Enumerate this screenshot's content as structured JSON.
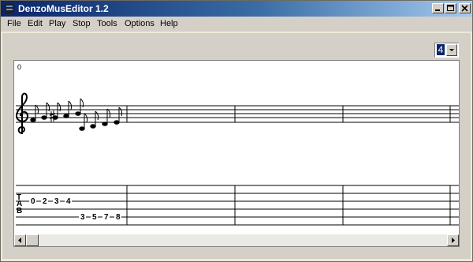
{
  "window": {
    "title": "DenzoMusEditor 1.2",
    "icon": "app-icon",
    "controls": [
      "minimize-icon",
      "maximize-icon",
      "close-icon"
    ]
  },
  "menu": {
    "items": [
      {
        "label": "File"
      },
      {
        "label": "Edit"
      },
      {
        "label": "Play"
      },
      {
        "label": "Stop"
      },
      {
        "label": "Tools"
      },
      {
        "label": "Options"
      },
      {
        "label": "Help"
      }
    ]
  },
  "toolbar": {
    "selector_value": "4"
  },
  "score": {
    "measure_number": "0",
    "tab_label": [
      "T",
      "A",
      "B"
    ],
    "tab_high_notes": [
      "0",
      "2",
      "3",
      "4"
    ],
    "tab_low_notes": [
      "3",
      "5",
      "7",
      "8"
    ]
  },
  "colors": {
    "titlebar_start": "#0a246a",
    "titlebar_end": "#a6caf0",
    "face": "#d4d0c8",
    "selection": "#0a246a"
  }
}
